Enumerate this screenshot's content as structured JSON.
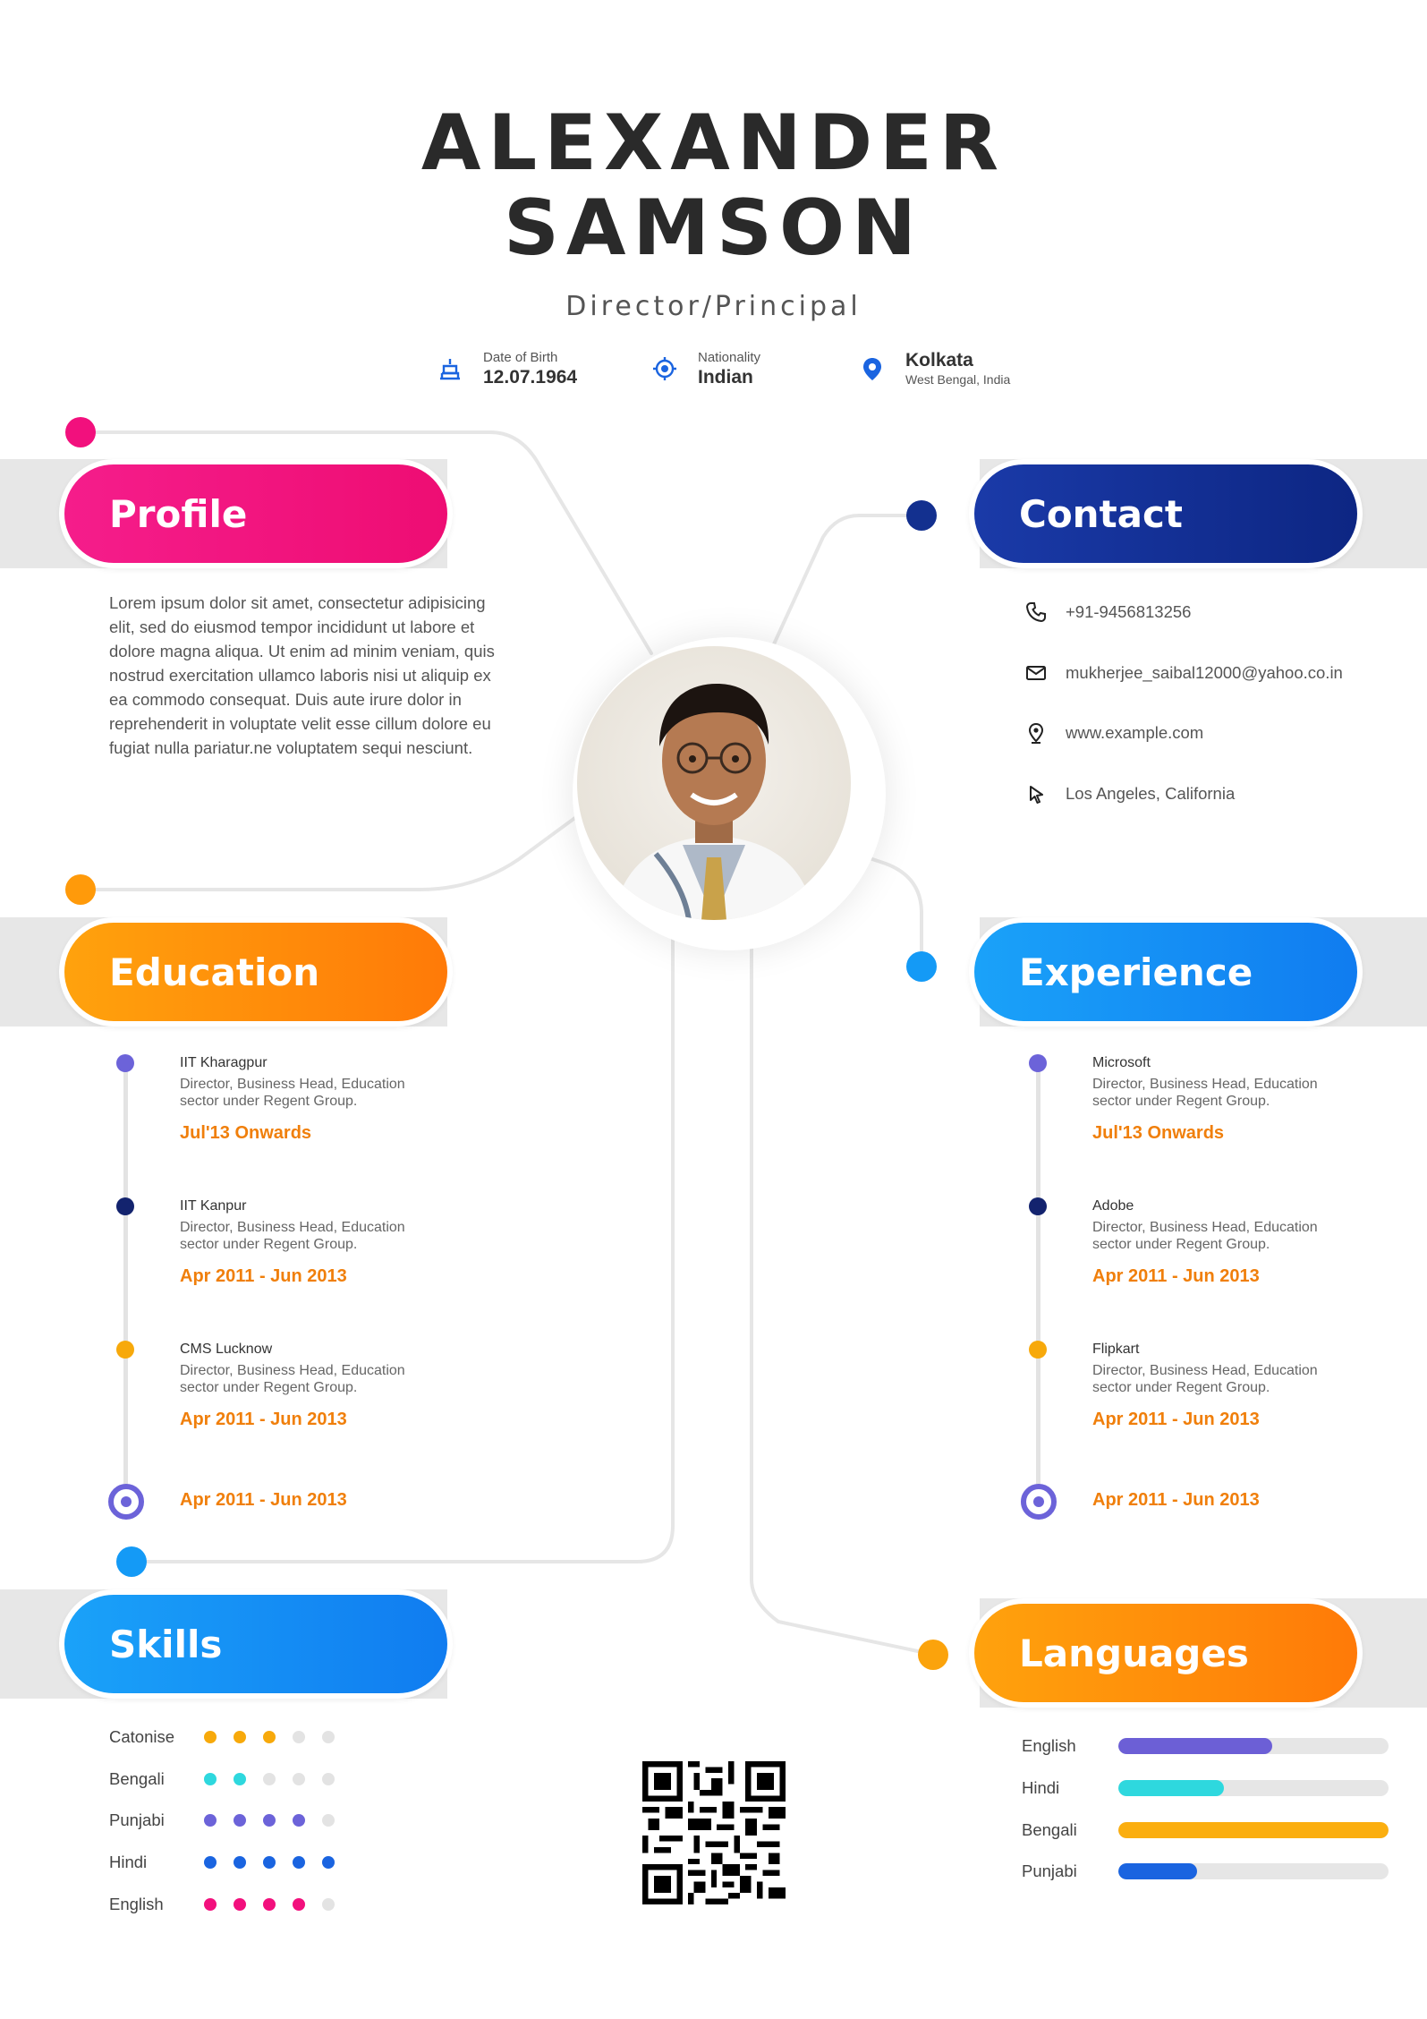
{
  "header": {
    "first_name": "ALEXANDER",
    "last_name": "SAMSON",
    "role": "Director/Principal"
  },
  "info": {
    "dob": {
      "label": "Date of Birth",
      "value": "12.07.1964",
      "icon": "birthday-cake-icon"
    },
    "nationality": {
      "label": "Nationality",
      "value": "Indian",
      "icon": "target-icon"
    },
    "location": {
      "value": "Kolkata",
      "sub": "West Bengal, India",
      "icon": "map-pin-icon"
    }
  },
  "profile": {
    "title": "Profile",
    "text": "Lorem ipsum dolor sit amet, consectetur adipisicing elit, sed do eiusmod tempor incididunt ut labore et dolore magna aliqua. Ut enim ad minim veniam, quis nostrud exercitation ullamco laboris nisi ut aliquip ex ea commodo consequat. Duis aute irure dolor in reprehenderit in voluptate velit esse cillum dolore eu fugiat nulla pariatur.ne voluptatem sequi nesciunt."
  },
  "contact": {
    "title": "Contact",
    "phone": "+91-9456813256",
    "email": "mukherjee_saibal12000@yahoo.co.in",
    "website": "www.example.com",
    "address": "Los Angeles, California"
  },
  "education": {
    "title": "Education",
    "items": [
      {
        "org": "IIT Kharagpur",
        "desc1": "Director, Business Head, Education",
        "desc2": "sector under Regent Group.",
        "date": "Jul'13 Onwards"
      },
      {
        "org": "IIT Kanpur",
        "desc1": "Director, Business Head, Education",
        "desc2": "sector under Regent Group.",
        "date": "Apr 2011 - Jun 2013"
      },
      {
        "org": "CMS Lucknow",
        "desc1": "Director, Business Head, Education",
        "desc2": "sector under Regent Group.",
        "date": "Apr 2011 - Jun 2013"
      }
    ],
    "last_date": "Apr 2011 - Jun 2013"
  },
  "experience": {
    "title": "Experience",
    "items": [
      {
        "org": "Microsoft",
        "desc1": "Director, Business Head, Education",
        "desc2": "sector under Regent Group.",
        "date": "Jul'13 Onwards"
      },
      {
        "org": "Adobe",
        "desc1": "Director, Business Head, Education",
        "desc2": "sector under Regent Group.",
        "date": "Apr 2011 - Jun 2013"
      },
      {
        "org": "Flipkart",
        "desc1": "Director, Business Head, Education",
        "desc2": "sector under Regent Group.",
        "date": "Apr 2011 - Jun 2013"
      }
    ],
    "last_date": "Apr 2011 - Jun 2013"
  },
  "skills": {
    "title": "Skills",
    "items": [
      {
        "name": "Catonise",
        "level": 3,
        "color": "#f7a90b"
      },
      {
        "name": "Bengali",
        "level": 2,
        "color": "#2ed8de"
      },
      {
        "name": "Punjabi",
        "level": 4,
        "color": "#6c63d9"
      },
      {
        "name": "Hindi",
        "level": 5,
        "color": "#1a64e0"
      },
      {
        "name": "English",
        "level": 4,
        "color": "#f2107d"
      }
    ],
    "max": 5
  },
  "languages": {
    "title": "Languages",
    "items": [
      {
        "name": "English",
        "level": 0.57,
        "color": "#6c5fd6"
      },
      {
        "name": "Hindi",
        "level": 0.39,
        "color": "#2ed8de"
      },
      {
        "name": "Bengali",
        "level": 1.0,
        "color": "#fbae0f"
      },
      {
        "name": "Punjabi",
        "level": 0.29,
        "color": "#1a64e0"
      }
    ]
  },
  "colors": {
    "pink": "#f2107d",
    "navy": "#13308f",
    "orange": "#ff8c0a",
    "blue": "#149af6",
    "accent_date": "#f07f0b"
  }
}
